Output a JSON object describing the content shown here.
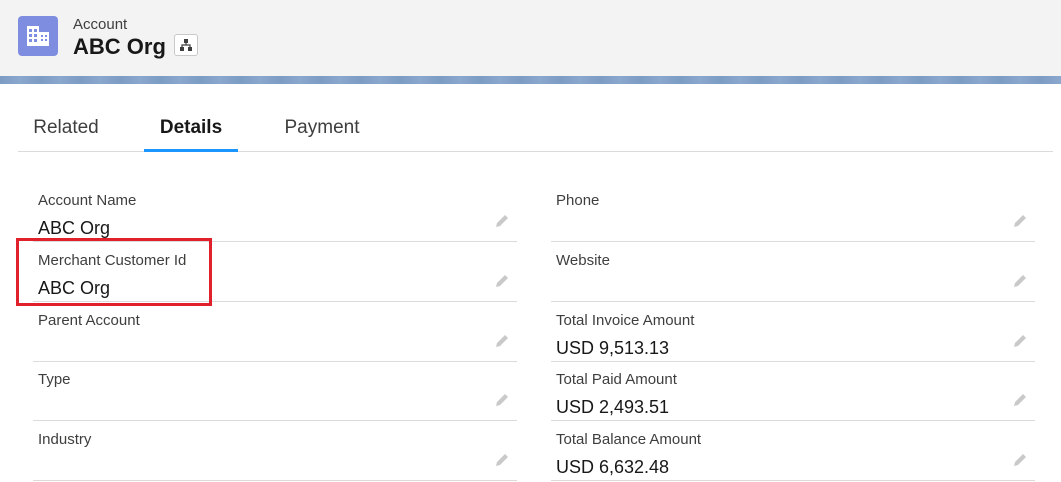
{
  "header": {
    "object_icon": "account-building-icon",
    "object_label": "Account",
    "record_title": "ABC Org",
    "hierarchy_icon": "hierarchy-icon"
  },
  "tabs": [
    {
      "label": "Related",
      "active": false
    },
    {
      "label": "Details",
      "active": true
    },
    {
      "label": "Payment",
      "active": false
    }
  ],
  "fields_left": [
    {
      "label": "Account Name",
      "value": "ABC Org"
    },
    {
      "label": "Merchant Customer Id",
      "value": "ABC Org"
    },
    {
      "label": "Parent Account",
      "value": ""
    },
    {
      "label": "Type",
      "value": ""
    },
    {
      "label": "Industry",
      "value": ""
    }
  ],
  "fields_right": [
    {
      "label": "Phone",
      "value": ""
    },
    {
      "label": "Website",
      "value": ""
    },
    {
      "label": "Total Invoice Amount",
      "value": "USD 9,513.13"
    },
    {
      "label": "Total Paid Amount",
      "value": "USD 2,493.51"
    },
    {
      "label": "Total Balance Amount",
      "value": "USD 6,632.48"
    }
  ],
  "colors": {
    "accent": "#1b96ff",
    "highlight": "#e0202a",
    "object_icon_bg": "#7f8de1"
  }
}
